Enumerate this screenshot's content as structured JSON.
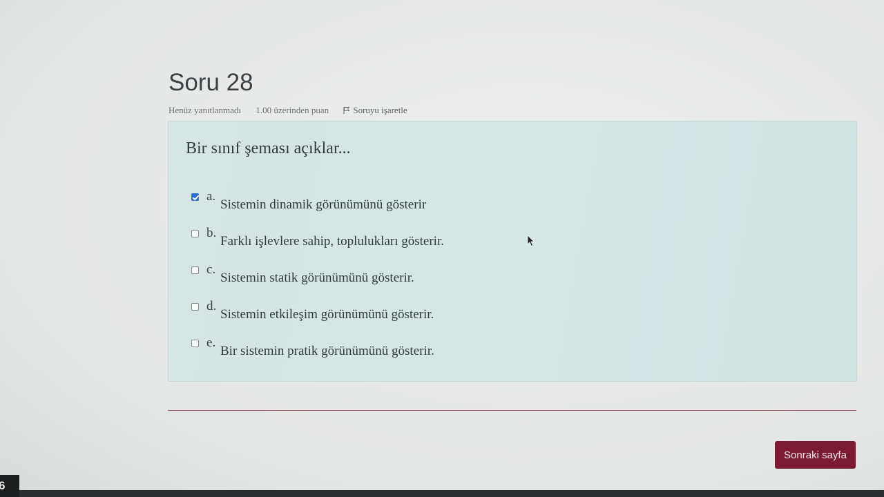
{
  "question": {
    "title": "Soru 28",
    "status": "Henüz yanıtlanmadı",
    "points": "1.00 üzerinden puan",
    "flag_label": "Soruyu işaretle",
    "text": "Bir sınıf şeması açıklar...",
    "answers": [
      {
        "letter": "a.",
        "text": "Sistemin dinamik görünümünü gösterir",
        "checked": true
      },
      {
        "letter": "b.",
        "text": "Farklı işlevlere sahip, toplulukları gösterir.",
        "checked": false
      },
      {
        "letter": "c.",
        "text": "Sistemin statik görünümünü gösterir.",
        "checked": false
      },
      {
        "letter": "d.",
        "text": "Sistemin etkileşim görünümünü gösterir.",
        "checked": false
      },
      {
        "letter": "e.",
        "text": "Bir sistemin pratik görünümünü gösterir.",
        "checked": false
      }
    ]
  },
  "navigation": {
    "next_label": "Sonraki sayfa"
  },
  "taskbar": {
    "corner_text": "6"
  },
  "colors": {
    "panel_bg": "#d5e6e5",
    "checkbox_checked": "#2a6fd6",
    "button_bg": "#7a1b33",
    "divider": "#8c4a55"
  },
  "icons": {
    "flag": "flag-icon",
    "cursor": "mouse-pointer-icon"
  }
}
